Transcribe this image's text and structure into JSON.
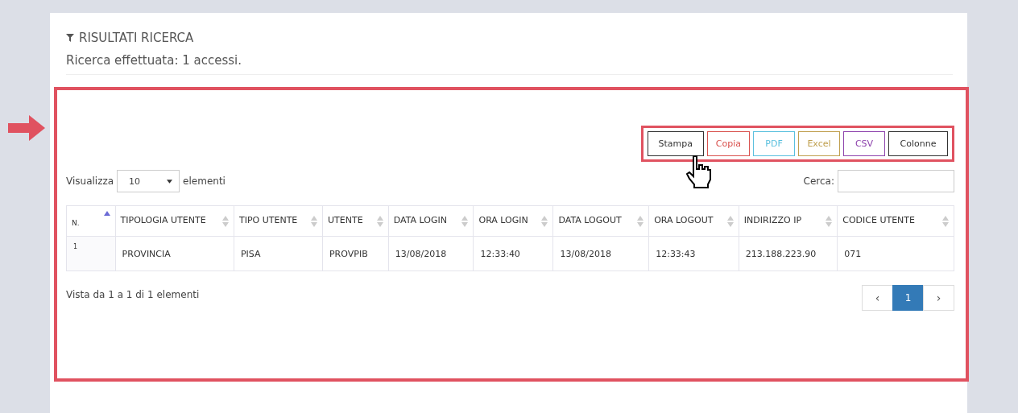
{
  "panel": {
    "title": "RISULTATI RICERCA",
    "summary": "Ricerca effettuata: 1 accessi."
  },
  "export_buttons": [
    {
      "label": "Stampa",
      "color": "#333333"
    },
    {
      "label": "Copia",
      "color": "#d9534f"
    },
    {
      "label": "PDF",
      "color": "#5bc0de"
    },
    {
      "label": "Excel",
      "color": "#c0a050"
    },
    {
      "label": "CSV",
      "color": "#8e44ad"
    },
    {
      "label": "Colonne",
      "color": "#333333"
    }
  ],
  "length": {
    "label_before": "Visualizza",
    "value": "10",
    "label_after": "elementi"
  },
  "search": {
    "label": "Cerca:"
  },
  "table": {
    "columns": [
      {
        "label": "N.",
        "sorted": true
      },
      {
        "label": "TIPOLOGIA UTENTE",
        "sorted": false
      },
      {
        "label": "TIPO UTENTE",
        "sorted": false
      },
      {
        "label": "UTENTE",
        "sorted": false
      },
      {
        "label": "DATA LOGIN",
        "sorted": false
      },
      {
        "label": "ORA LOGIN",
        "sorted": false
      },
      {
        "label": "DATA LOGOUT",
        "sorted": false
      },
      {
        "label": "ORA LOGOUT",
        "sorted": false
      },
      {
        "label": "INDIRIZZO IP",
        "sorted": false
      },
      {
        "label": "CODICE UTENTE",
        "sorted": false
      }
    ],
    "rows": [
      [
        "1",
        "PROVINCIA",
        "PISA",
        "PROVPIB",
        "13/08/2018",
        "12:33:40",
        "13/08/2018",
        "12:33:43",
        "213.188.223.90",
        "071"
      ]
    ]
  },
  "info": "Vista da 1 a 1 di 1 elementi",
  "pagination": [
    {
      "label": "‹",
      "selected": false
    },
    {
      "label": "1",
      "selected": true
    },
    {
      "label": "›",
      "selected": false
    }
  ]
}
